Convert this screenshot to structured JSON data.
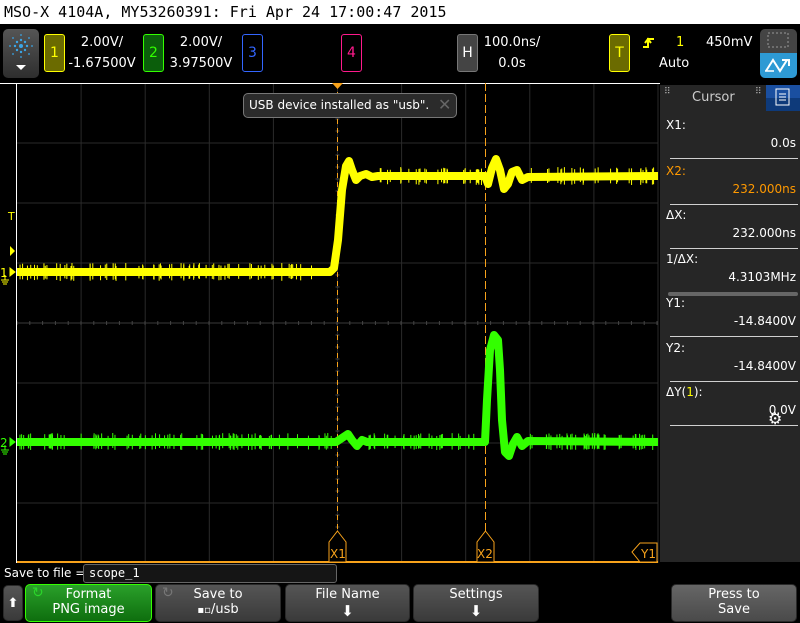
{
  "title": "MSO-X 4104A, MY53260391: Fri Apr 24 17:00:47 2015",
  "channels": [
    {
      "num": "1",
      "scale": "2.00V/",
      "offset": "-1.67500V",
      "color": "#ffff00"
    },
    {
      "num": "2",
      "scale": "2.00V/",
      "offset": "3.97500V",
      "color": "#33ff00"
    },
    {
      "num": "3",
      "color": "#3366ff"
    },
    {
      "num": "4",
      "color": "#ff1a8c"
    }
  ],
  "horizontal": {
    "label": "H",
    "scale": "100.0ns/",
    "delay": "0.0s"
  },
  "trigger": {
    "label": "T",
    "source": "1",
    "level": "450mV",
    "mode": "Auto",
    "slope": "rising-edge-icon"
  },
  "toast": {
    "message": "USB device installed as \"usb\"."
  },
  "display": {
    "trigger_marker": "T",
    "ch1_marker": "1",
    "ch2_marker": "2",
    "x1_marker": "X1",
    "x2_marker": "X2",
    "y1_marker": "Y1"
  },
  "cursor_panel": {
    "title": "Cursor",
    "rows": [
      {
        "label": "X1:",
        "value": "0.0s",
        "color": "#ffffff"
      },
      {
        "label": "X2:",
        "value": "232.000ns",
        "color": "#ff9900"
      },
      {
        "label": "ΔX:",
        "value": "232.000ns",
        "color": "#ffffff"
      },
      {
        "label": "1/ΔX:",
        "value": "4.3103MHz",
        "color": "#ffffff"
      },
      {
        "label": "Y1:",
        "value": "-14.8400V",
        "color": "#ffffff"
      },
      {
        "label": "Y2:",
        "value": "-14.8400V",
        "color": "#ffffff"
      },
      {
        "label_prefix": "ΔY(",
        "label_ch": "1",
        "label_suffix": "):",
        "value": "0.0V",
        "color": "#ffffff"
      }
    ]
  },
  "save": {
    "label": "Save to file =",
    "filename": "scope_1"
  },
  "softkeys": [
    {
      "line1": "Format",
      "line2": "PNG image"
    },
    {
      "line1": "Save to",
      "line2": "/usb"
    },
    {
      "line1": "File Name"
    },
    {
      "line1": "Settings"
    },
    {
      "line1": "Press to",
      "line2": "Save"
    }
  ]
}
